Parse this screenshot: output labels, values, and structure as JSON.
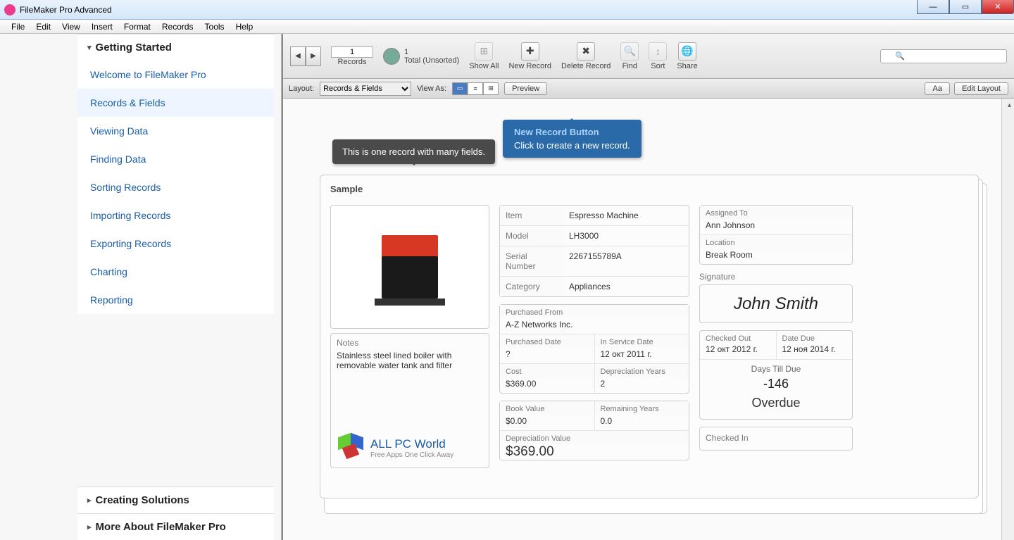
{
  "window": {
    "title": "FileMaker Pro Advanced"
  },
  "menu": [
    "File",
    "Edit",
    "View",
    "Insert",
    "Format",
    "Records",
    "Tools",
    "Help"
  ],
  "sidebar": {
    "section1": "Getting Started",
    "items": [
      "Welcome to FileMaker Pro",
      "Records & Fields",
      "Viewing Data",
      "Finding Data",
      "Sorting Records",
      "Importing Records",
      "Exporting Records",
      "Charting",
      "Reporting"
    ],
    "section2": "Creating Solutions",
    "section3": "More About FileMaker Pro"
  },
  "toolbar": {
    "record_num": "1",
    "records_label": "Records",
    "total_count": "1",
    "total_label": "Total (Unsorted)",
    "showall": "Show All",
    "newrecord": "New Record",
    "deleterecord": "Delete Record",
    "find": "Find",
    "sort": "Sort",
    "share": "Share"
  },
  "layoutbar": {
    "layout_label": "Layout:",
    "layout_value": "Records & Fields",
    "viewas_label": "View As:",
    "preview": "Preview",
    "aa": "Aa",
    "edit": "Edit Layout"
  },
  "callouts": {
    "dark": "This is one record with many fields.",
    "blue_title": "New Record Button",
    "blue_body": "Click to create a new record."
  },
  "record": {
    "sample": "Sample",
    "notes_label": "Notes",
    "notes": "Stainless steel lined boiler with removable water tank and filter",
    "watermark_title": "ALL PC World",
    "watermark_sub": "Free Apps One Click Away",
    "item_l": "Item",
    "item_v": "Espresso Machine",
    "model_l": "Model",
    "model_v": "LH3000",
    "serial_l": "Serial Number",
    "serial_v": "2267155789A",
    "category_l": "Category",
    "category_v": "Appliances",
    "purchfrom_l": "Purchased From",
    "purchfrom_v": "A-Z Networks Inc.",
    "purchdate_l": "Purchased Date",
    "purchdate_v": "?",
    "inservice_l": "In Service Date",
    "inservice_v": "12 окт 2011 г.",
    "cost_l": "Cost",
    "cost_v": "$369.00",
    "depyears_l": "Depreciation Years",
    "depyears_v": "2",
    "bookval_l": "Book Value",
    "bookval_v": "$0.00",
    "remyears_l": "Remaining Years",
    "remyears_v": "0.0",
    "depval_l": "Depreciation Value",
    "depval_v": "$369.00",
    "assigned_l": "Assigned To",
    "assigned_v": "Ann Johnson",
    "location_l": "Location",
    "location_v": "Break Room",
    "signature_l": "Signature",
    "signature_v": "John Smith",
    "checkedout_l": "Checked Out",
    "checkedout_v": "12 окт 2012 г.",
    "datedue_l": "Date Due",
    "datedue_v": "12 ноя 2014 г.",
    "daystill_l": "Days Till Due",
    "daystill_v": "-146",
    "overdue": "Overdue",
    "checkedin_l": "Checked In"
  }
}
